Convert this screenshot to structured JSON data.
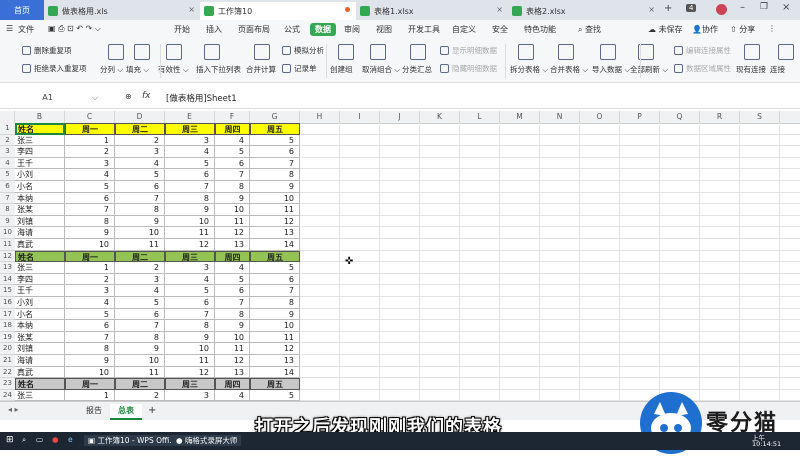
{
  "tabs": [
    {
      "label": "首页",
      "active": false,
      "home": true
    },
    {
      "label": "做表格用.xls",
      "active": false,
      "icon_color": "#35a853"
    },
    {
      "label": "工作簿10",
      "active": true,
      "icon_color": "#35a853",
      "modified": true
    },
    {
      "label": "表格1.xlsx",
      "active": false,
      "icon_color": "#35a853"
    },
    {
      "label": "表格2.xlsx",
      "active": false,
      "icon_color": "#35a853"
    }
  ],
  "tab_count": "4",
  "menu": {
    "file": "文件",
    "items": [
      "开始",
      "插入",
      "页面布局",
      "公式",
      "数据",
      "审阅",
      "视图",
      "开发工具",
      "自定义",
      "安全",
      "特色功能"
    ],
    "active": "数据",
    "search": "查找",
    "save_status": "未保存",
    "collab": "协作",
    "share": "分享"
  },
  "ribbon": {
    "delete_dup": "删除重复项",
    "reject_dup": "拒绝录入重复项",
    "split_col": "分列",
    "fill": "填充",
    "validity": "有效性",
    "dropdown": "插入下拉列表",
    "merge_calc": "合并计算",
    "simulate": "模拟分析",
    "record": "记录单",
    "group": "创建组",
    "ungroup": "取消组合",
    "subtotal": "分类汇总",
    "show_detail": "显示明细数据",
    "hide_detail": "隐藏明细数据",
    "split_table": "拆分表格",
    "merge_table": "合并表格",
    "import": "导入数据",
    "refresh_all": "全部刷新",
    "edit_link": "编辑连接属性",
    "data_range": "数据区域属性",
    "existing_conn": "现有连接",
    "conn": "连接"
  },
  "formula_bar": {
    "name_box": "A1",
    "fx": "fx",
    "content": "[做表格用]Sheet1"
  },
  "columns": [
    "B",
    "C",
    "D",
    "E",
    "F",
    "G",
    "H",
    "I",
    "J",
    "K",
    "L",
    "M",
    "N",
    "O",
    "P",
    "Q",
    "R",
    "S"
  ],
  "header_labels": [
    "姓名",
    "周一",
    "周二",
    "周三",
    "周四",
    "周五"
  ],
  "header_colors": [
    "#ffff00",
    "#92c353",
    "#c8c8c8"
  ],
  "blocks": [
    {
      "rows": [
        {
          "name": "张三",
          "v": [
            1,
            2,
            3,
            4,
            5
          ]
        },
        {
          "name": "李四",
          "v": [
            2,
            3,
            4,
            5,
            6
          ]
        },
        {
          "name": "王千",
          "v": [
            3,
            4,
            5,
            6,
            7
          ]
        },
        {
          "name": "小刘",
          "v": [
            4,
            5,
            6,
            7,
            8
          ]
        },
        {
          "name": "小名",
          "v": [
            5,
            6,
            7,
            8,
            9
          ]
        },
        {
          "name": "本纳",
          "v": [
            6,
            7,
            8,
            9,
            10
          ]
        },
        {
          "name": "张某",
          "v": [
            7,
            8,
            9,
            10,
            11
          ]
        },
        {
          "name": "刘镇",
          "v": [
            8,
            9,
            10,
            11,
            12
          ]
        },
        {
          "name": "海请",
          "v": [
            9,
            10,
            11,
            12,
            13
          ]
        },
        {
          "name": "真武",
          "v": [
            10,
            11,
            12,
            13,
            14
          ]
        }
      ]
    },
    {
      "rows": [
        {
          "name": "张三",
          "v": [
            1,
            2,
            3,
            4,
            5
          ]
        },
        {
          "name": "李四",
          "v": [
            2,
            3,
            4,
            5,
            6
          ]
        },
        {
          "name": "王千",
          "v": [
            3,
            4,
            5,
            6,
            7
          ]
        },
        {
          "name": "小刘",
          "v": [
            4,
            5,
            6,
            7,
            8
          ]
        },
        {
          "name": "小名",
          "v": [
            5,
            6,
            7,
            8,
            9
          ]
        },
        {
          "name": "本纳",
          "v": [
            6,
            7,
            8,
            9,
            10
          ]
        },
        {
          "name": "张某",
          "v": [
            7,
            8,
            9,
            10,
            11
          ]
        },
        {
          "name": "刘镇",
          "v": [
            8,
            9,
            10,
            11,
            12
          ]
        },
        {
          "name": "海请",
          "v": [
            9,
            10,
            11,
            12,
            13
          ]
        },
        {
          "name": "真武",
          "v": [
            10,
            11,
            12,
            13,
            14
          ]
        }
      ]
    },
    {
      "rows": [
        {
          "name": "张三",
          "v": [
            1,
            2,
            3,
            4,
            5
          ]
        }
      ]
    }
  ],
  "sheet_tabs": [
    {
      "label": "报告",
      "active": false
    },
    {
      "label": "总表",
      "active": true
    }
  ],
  "add_sheet": "+",
  "caption": "打开之后发现刚刚我们的表格",
  "taskbar": {
    "wps": "工作簿10 - WPS Offi...",
    "recorder": "嗨格式录屏大师",
    "time": "10:14:51",
    "ampm": "上午"
  },
  "watermark": "零分猫"
}
